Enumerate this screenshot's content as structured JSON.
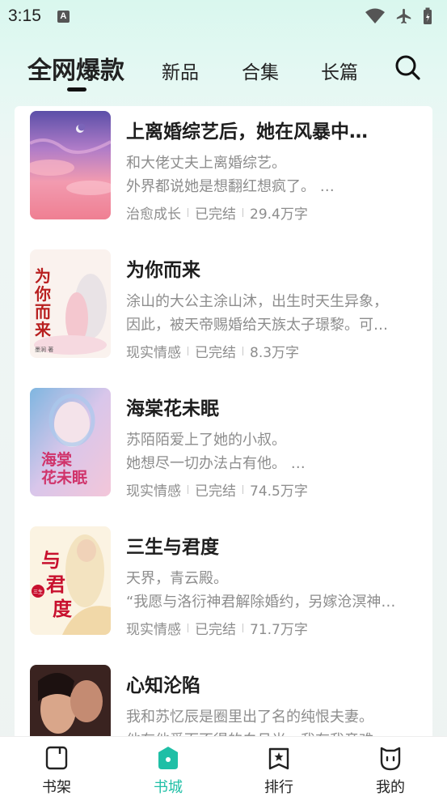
{
  "status": {
    "time": "3:15",
    "notif": "A"
  },
  "tabs": [
    {
      "label": "全网爆款",
      "active": true
    },
    {
      "label": "新品"
    },
    {
      "label": "合集"
    },
    {
      "label": "长篇"
    }
  ],
  "books": [
    {
      "title": "上离婚综艺后，她在风暴中…",
      "desc1": "和大佬丈夫上离婚综艺。",
      "desc2": "外界都说她是想翻红想疯了。 …",
      "category": "治愈成长",
      "status": "已完结",
      "words": "29.4万字"
    },
    {
      "title": "为你而来",
      "desc1": "涂山的大公主涂山沐，出生时天生异象，",
      "desc2": "因此，被天帝赐婚给天族太子璟黎。可…",
      "category": "现实情感",
      "status": "已完结",
      "words": "8.3万字",
      "cover_text": "为你而来",
      "cover_author": "墨涧 著"
    },
    {
      "title": "海棠花未眠",
      "desc1": "苏陌陌爱上了她的小叔。",
      "desc2": "她想尽一切办法占有他。 …",
      "category": "现实情感",
      "status": "已完结",
      "words": "74.5万字",
      "cover_text_1": "海棠",
      "cover_text_2": "花未眠"
    },
    {
      "title": "三生与君度",
      "desc1": "天界，青云殿。",
      "desc2": "“我愿与洛衍神君解除婚约，另嫁沧溟神…",
      "category": "现实情感",
      "status": "已完结",
      "words": "71.7万字",
      "cover_text_1": "与",
      "cover_text_2": "君",
      "cover_text_3": "度",
      "cover_badge": "三生"
    },
    {
      "title": "心知沦陷",
      "desc1": "我和苏忆辰是圈里出了名的纯恨夫妻。",
      "desc2": "他有他爱而不得的白月光，我有我竞难…",
      "category": "",
      "status": "",
      "words": ""
    }
  ],
  "nav": [
    {
      "label": "书架",
      "icon": "bookshelf-icon"
    },
    {
      "label": "书城",
      "icon": "bookstore-icon",
      "active": true
    },
    {
      "label": "排行",
      "icon": "ranking-icon"
    },
    {
      "label": "我的",
      "icon": "profile-icon"
    }
  ],
  "colors": {
    "accent": "#1fbfa6",
    "text": "#222222",
    "muted": "#8d8d8d"
  }
}
